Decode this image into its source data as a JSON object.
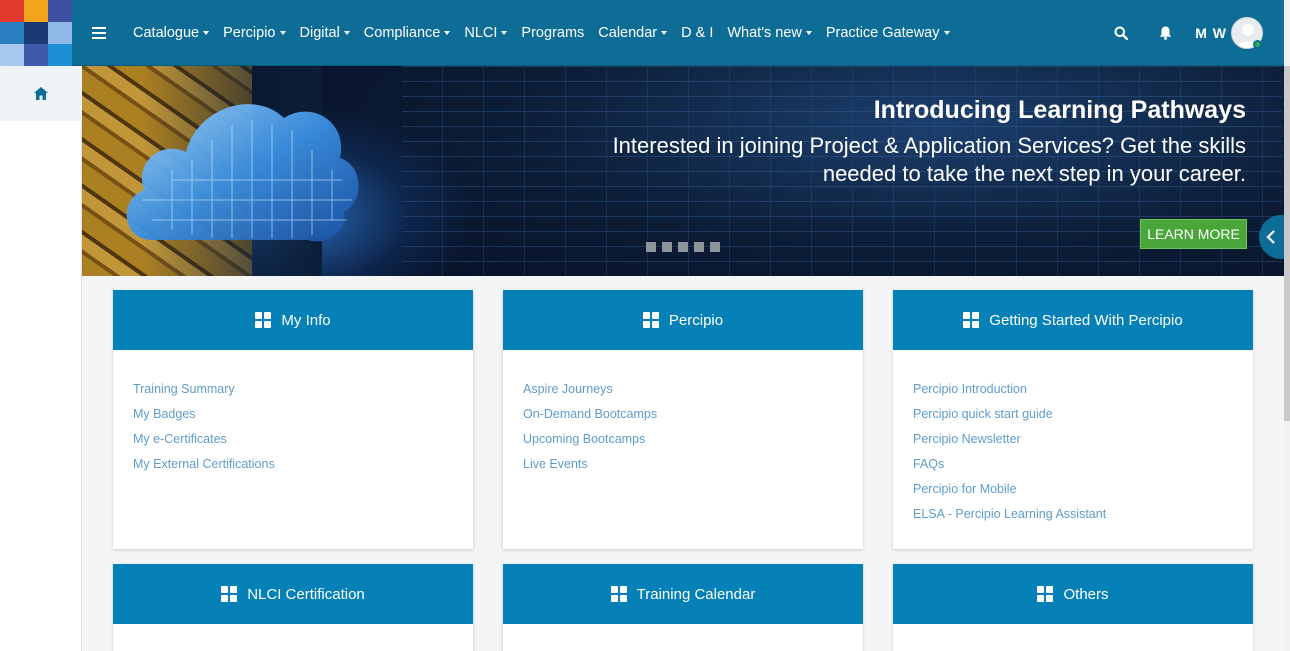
{
  "navbar": {
    "menu": [
      {
        "label": "Catalogue",
        "dropdown": true
      },
      {
        "label": "Percipio",
        "dropdown": true
      },
      {
        "label": "Digital",
        "dropdown": true
      },
      {
        "label": "Compliance",
        "dropdown": true
      },
      {
        "label": "NLCI",
        "dropdown": true
      },
      {
        "label": "Programs",
        "dropdown": false
      },
      {
        "label": "Calendar",
        "dropdown": true
      },
      {
        "label": "D & I",
        "dropdown": false
      },
      {
        "label": "What's new",
        "dropdown": true
      },
      {
        "label": "Practice Gateway",
        "dropdown": true
      }
    ],
    "user_initials": "M W"
  },
  "banner": {
    "title": "Introducing Learning Pathways",
    "text": "Interested in joining Project & Application Services? Get the skills needed to take the next step in your career.",
    "cta_label": "LEARN MORE",
    "slide_count": 5
  },
  "cards": [
    {
      "title": "My Info",
      "links": [
        "Training Summary",
        "My Badges",
        "My e-Certificates",
        "My External Certifications"
      ]
    },
    {
      "title": "Percipio",
      "links": [
        "Aspire Journeys",
        "On-Demand Bootcamps",
        "Upcoming Bootcamps",
        "Live Events"
      ]
    },
    {
      "title": "Getting Started With Percipio",
      "links": [
        "Percipio Introduction",
        "Percipio quick start guide",
        "Percipio Newsletter",
        "FAQs",
        "Percipio for Mobile",
        "ELSA - Percipio Learning Assistant"
      ]
    },
    {
      "title": "NLCI Certification",
      "links": []
    },
    {
      "title": "Training Calendar",
      "links": []
    },
    {
      "title": "Others",
      "links": []
    }
  ],
  "colors": {
    "navbar": "#0e6d96",
    "card_header": "#0581b7",
    "link": "#5f9cc9",
    "cta": "#4aa63a"
  },
  "icons": {
    "menu": "hamburger-icon",
    "home": "home-icon",
    "search": "search-icon",
    "notifications": "bell-icon",
    "card": "grid-icon",
    "drawer": "chevron-left-icon"
  }
}
